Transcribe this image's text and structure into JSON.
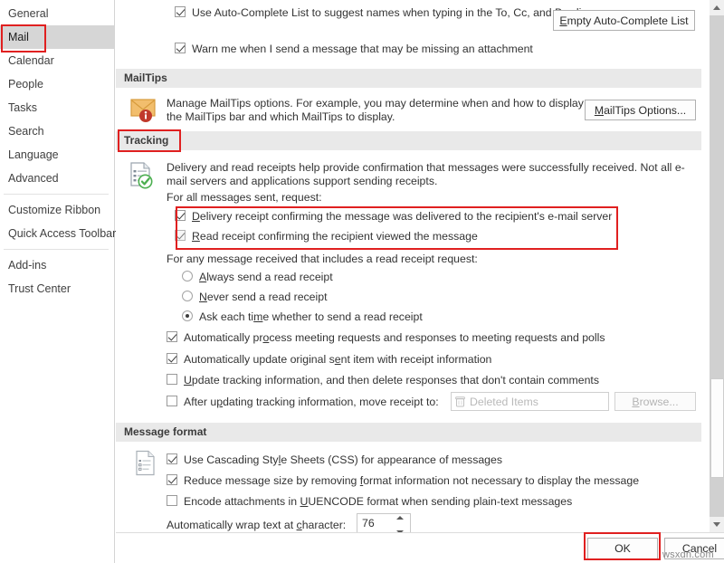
{
  "sidebar": {
    "items": [
      {
        "label": "General",
        "selected": false,
        "annotated": false
      },
      {
        "label": "Mail",
        "selected": true,
        "annotated": true
      },
      {
        "label": "Calendar",
        "selected": false,
        "annotated": false
      },
      {
        "label": "People",
        "selected": false,
        "annotated": false
      },
      {
        "label": "Tasks",
        "selected": false,
        "annotated": false
      },
      {
        "label": "Search",
        "selected": false,
        "annotated": false
      },
      {
        "label": "Language",
        "selected": false,
        "annotated": false
      },
      {
        "label": "Advanced",
        "selected": false,
        "annotated": false
      },
      {
        "label": "Customize Ribbon",
        "selected": false,
        "annotated": false
      },
      {
        "label": "Quick Access Toolbar",
        "selected": false,
        "annotated": false
      },
      {
        "label": "Add-ins",
        "selected": false,
        "annotated": false
      },
      {
        "label": "Trust Center",
        "selected": false,
        "annotated": false
      }
    ]
  },
  "send_messages": {
    "autocomplete_checkbox": "Use Auto-Complete List to suggest names when typing in the To, Cc, and Bcc lines",
    "warn_attachment_checkbox": "Warn me when I send a message that may be missing an attachment",
    "empty_autocomplete_button": "Empty Auto-Complete List"
  },
  "mailtips": {
    "heading": "MailTips",
    "description": "Manage MailTips options. For example, you may determine when and how to display the MailTips bar and which MailTips to display.",
    "options_button": "MailTips Options..."
  },
  "tracking": {
    "heading": "Tracking",
    "description": "Delivery and read receipts help provide confirmation that messages were successfully received. Not all e-mail servers and applications support sending receipts.",
    "for_all_sent_label": "For all messages sent, request:",
    "delivery_receipt": "Delivery receipt confirming the message was delivered to the recipient's e-mail server",
    "read_receipt": "Read receipt confirming the recipient viewed the message",
    "for_any_received_label": "For any message received that includes a read receipt request:",
    "radio_always": "Always send a read receipt",
    "radio_never": "Never send a read receipt",
    "radio_ask": "Ask each time whether to send a read receipt",
    "auto_process": "Automatically process meeting requests and responses to meeting requests and polls",
    "auto_update": "Automatically update original sent item with receipt information",
    "update_tracking": "Update tracking information, and then delete responses that don't contain comments",
    "after_updating": "After updating tracking information, move receipt to:",
    "move_receipt_field_value": "Deleted Items",
    "browse_button": "Browse..."
  },
  "message_format": {
    "heading": "Message format",
    "use_css": "Use Cascading Style Sheets (CSS) for appearance of messages",
    "reduce_size": "Reduce message size by removing format information not necessary to display the message",
    "encode_uuencode": "Encode attachments in UUENCODE format when sending plain-text messages",
    "wrap_label": "Automatically wrap text at character:",
    "wrap_value": "76"
  },
  "footer": {
    "ok_button": "OK",
    "cancel_button": "Cancel"
  },
  "watermark": {
    "text": "wsxdn.com"
  },
  "colors": {
    "annotation_red": "#e02020",
    "section_header_bg": "#e9e9e9",
    "sidebar_selected_bg": "#d6d6d6",
    "mailtips_envelope": "#f0b352",
    "mailtips_badge": "#c0392b",
    "tracking_check_green": "#4caf50"
  }
}
